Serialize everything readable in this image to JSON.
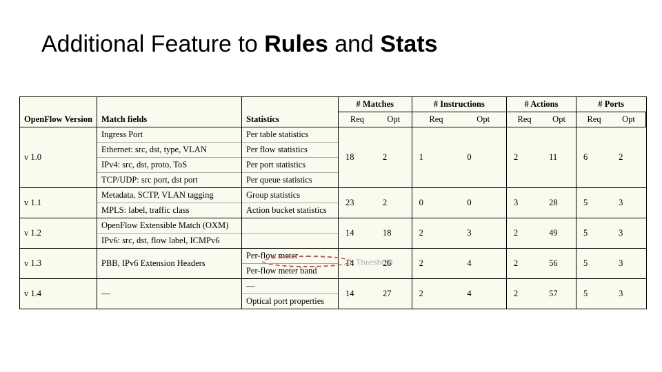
{
  "title": {
    "pre": "Additional Feature to ",
    "b1": "Rules",
    "mid": " and ",
    "b2": "Stats"
  },
  "headers": {
    "c1": "OpenFlow Version",
    "c2": "Match fields",
    "c3": "Statistics",
    "g1": "# Matches",
    "g2": "# Instructions",
    "g3": "# Actions",
    "g4": "# Ports",
    "req": "Req",
    "opt": "Opt"
  },
  "v10": {
    "ver": "v 1.0",
    "m": [
      "Ingress Port",
      "Ethernet: src, dst, type, VLAN",
      "IPv4: src, dst, proto, ToS",
      "TCP/UDP: src port, dst port"
    ],
    "s": [
      "Per table statistics",
      "Per flow statistics",
      "Per port statistics",
      "Per queue statistics"
    ],
    "n": [
      "18",
      "2",
      "1",
      "0",
      "2",
      "11",
      "6",
      "2"
    ]
  },
  "v11": {
    "ver": "v 1.1",
    "m": [
      "Metadata, SCTP, VLAN tagging",
      "MPLS: label, traffic class"
    ],
    "s": [
      "Group statistics",
      "Action bucket statistics"
    ],
    "n": [
      "23",
      "2",
      "0",
      "0",
      "3",
      "28",
      "5",
      "3"
    ]
  },
  "v12": {
    "ver": "v 1.2",
    "m": [
      "OpenFlow Extensible Match (OXM)",
      "IPv6: src, dst, flow label, ICMPv6"
    ],
    "s": [
      "",
      ""
    ],
    "n": [
      "14",
      "18",
      "2",
      "3",
      "2",
      "49",
      "5",
      "3"
    ]
  },
  "v13": {
    "ver": "v 1.3",
    "m": [
      "PBB, IPv6 Extension Headers"
    ],
    "s": [
      "Per-flow meter",
      "Per-flow meter band"
    ],
    "n": [
      "14",
      "26",
      "2",
      "4",
      "2",
      "56",
      "5",
      "3"
    ]
  },
  "v14": {
    "ver": "v 1.4",
    "m": [
      "—"
    ],
    "s": [
      "—",
      "Optical port properties"
    ],
    "n": [
      "14",
      "27",
      "2",
      "4",
      "2",
      "57",
      "5",
      "3"
    ]
  },
  "annotation": "Threshold"
}
